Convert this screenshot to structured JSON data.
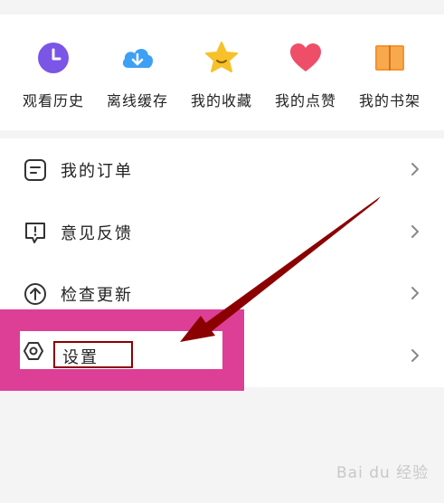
{
  "quick_actions": [
    {
      "label": "观看历史",
      "icon": "clock-icon",
      "color": "#7b55e6"
    },
    {
      "label": "离线缓存",
      "icon": "cloud-download-icon",
      "color": "#3ea0f4"
    },
    {
      "label": "我的收藏",
      "icon": "star-icon",
      "color": "#f6c12a"
    },
    {
      "label": "我的点赞",
      "icon": "heart-icon",
      "color": "#ef4e68"
    },
    {
      "label": "我的书架",
      "icon": "book-icon",
      "color": "#f5922f"
    }
  ],
  "menu": [
    {
      "label": "我的订单",
      "icon": "order-icon"
    },
    {
      "label": "意见反馈",
      "icon": "feedback-icon"
    },
    {
      "label": "检查更新",
      "icon": "update-icon"
    },
    {
      "label": "设置",
      "icon": "settings-icon"
    }
  ],
  "watermark": "Bai du 经验",
  "colors": {
    "highlight_block": "#dc3f95",
    "annotation_arrow": "#8b0000"
  }
}
